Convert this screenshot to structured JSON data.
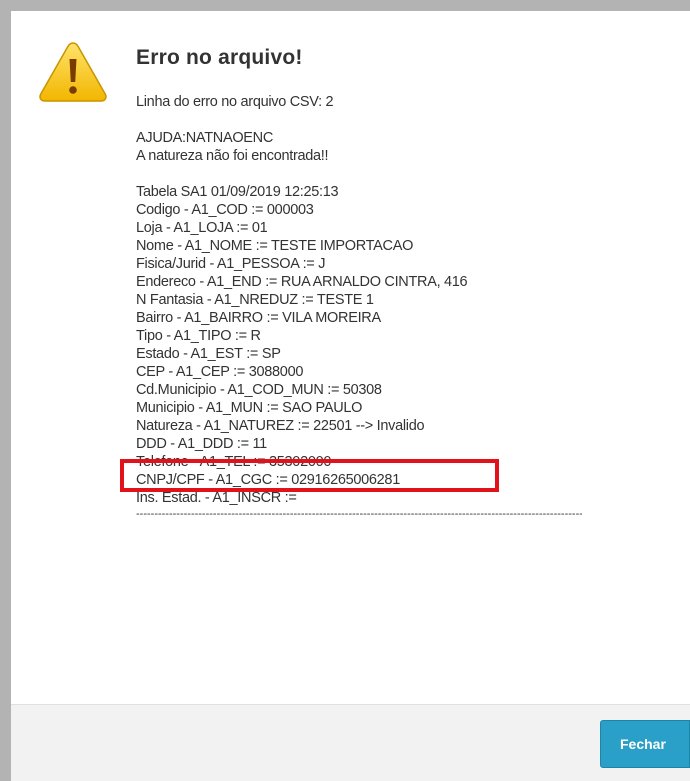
{
  "dialog": {
    "title": "Erro no arquivo!",
    "csv_line": "Linha do erro no arquivo CSV: 2",
    "help_code": "AJUDA:NATNAOENC",
    "help_message": "A natureza não foi encontrada!!",
    "table_header": "Tabela SA1 01/09/2019 12:25:13",
    "fields": [
      "Codigo - A1_COD := 000003",
      "Loja - A1_LOJA := 01",
      "Nome - A1_NOME := TESTE IMPORTACAO",
      "Fisica/Jurid - A1_PESSOA := J",
      "Endereco - A1_END := RUA ARNALDO CINTRA, 416",
      "N Fantasia - A1_NREDUZ := TESTE 1",
      "Bairro - A1_BAIRRO := VILA MOREIRA",
      "Tipo - A1_TIPO := R",
      "Estado - A1_EST := SP",
      "CEP - A1_CEP := 3088000",
      "Cd.Municipio - A1_COD_MUN := 50308",
      "Municipio - A1_MUN := SAO PAULO",
      "Natureza - A1_NATUREZ := 22501 --> Invalido",
      "DDD - A1_DDD := 11",
      "Telefone - A1_TEL := 35302000",
      "CNPJ/CPF - A1_CGC := 02916265006281",
      "Ins. Estad. - A1_INSCR :="
    ],
    "divider": "--------------------------------------------------------------------------------------------------------------------------------",
    "icon": "warning-icon"
  },
  "footer": {
    "close_label": "Fechar"
  },
  "colors": {
    "accent": "#2aa0c8",
    "highlight": "#e2121b",
    "text": "#333333",
    "icon_fill": "#f5c000"
  }
}
